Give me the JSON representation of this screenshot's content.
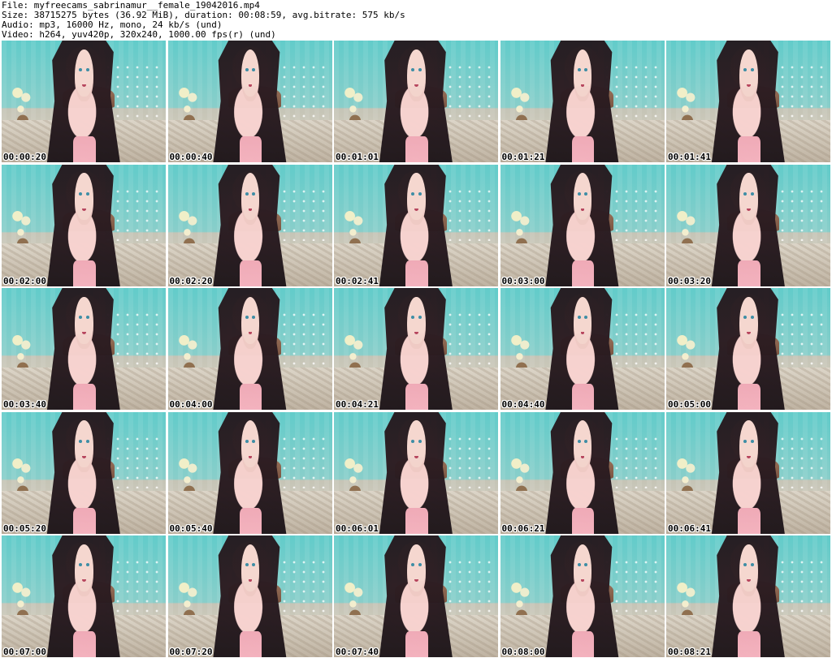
{
  "header": {
    "file": "File: myfreecams_sabrinamur__female_19042016.mp4",
    "size": "Size: 38715275 bytes (36.92 MiB), duration: 00:08:59, avg.bitrate: 575 kb/s",
    "audio": "Audio: mp3, 16000 Hz, mono, 24 kb/s (und)",
    "video": "Video: h264, yuv420p, 320x240, 1000.00 fps(r) (und)"
  },
  "thumbnails": [
    {
      "timestamp": "00:00:20"
    },
    {
      "timestamp": "00:00:40"
    },
    {
      "timestamp": "00:01:01"
    },
    {
      "timestamp": "00:01:21"
    },
    {
      "timestamp": "00:01:41"
    },
    {
      "timestamp": "00:02:00"
    },
    {
      "timestamp": "00:02:20"
    },
    {
      "timestamp": "00:02:41"
    },
    {
      "timestamp": "00:03:00"
    },
    {
      "timestamp": "00:03:20"
    },
    {
      "timestamp": "00:03:40"
    },
    {
      "timestamp": "00:04:00"
    },
    {
      "timestamp": "00:04:21"
    },
    {
      "timestamp": "00:04:40"
    },
    {
      "timestamp": "00:05:00"
    },
    {
      "timestamp": "00:05:20"
    },
    {
      "timestamp": "00:05:40"
    },
    {
      "timestamp": "00:06:01"
    },
    {
      "timestamp": "00:06:21"
    },
    {
      "timestamp": "00:06:41"
    },
    {
      "timestamp": "00:07:00"
    },
    {
      "timestamp": "00:07:20"
    },
    {
      "timestamp": "00:07:40"
    },
    {
      "timestamp": "00:08:00"
    },
    {
      "timestamp": "00:08:21"
    }
  ]
}
